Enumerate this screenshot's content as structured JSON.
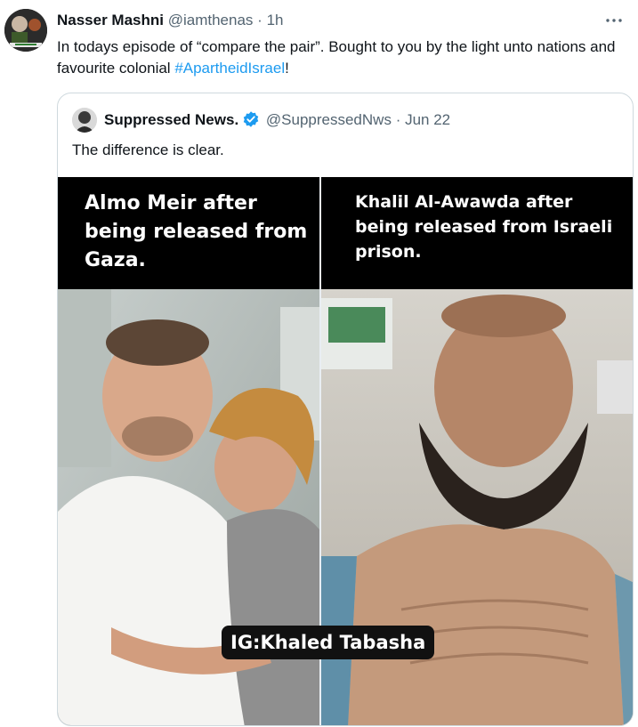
{
  "tweet": {
    "author_name": "Nasser Mashni",
    "author_handle": "@iamthenas",
    "separator": "·",
    "time": "1h",
    "text_before": "In todays episode of “compare the pair”. Bought to you by the light unto nations and favourite colonial ",
    "hashtag": "#ApartheidIsrael",
    "text_after": "!",
    "more_icon": "more-horizontal-icon"
  },
  "quote": {
    "author_name": "Suppressed News.",
    "verified_icon": "verified-badge-icon",
    "author_handle": "@SuppressedNws",
    "separator": "·",
    "date": "Jun 22",
    "text": "The difference is clear.",
    "media": {
      "left_caption": "Almo Meir after\nbeing released from\nGaza.",
      "right_caption": "Khalil Al-Awawda after\nbeing released from Israeli\nprison.",
      "watermark": "IG:Khaled Tabasha"
    }
  },
  "colors": {
    "text": "#0f1419",
    "secondary": "#536471",
    "link": "#1d9bf0",
    "border": "#cfd9de",
    "verified": "#1d9bf0"
  }
}
